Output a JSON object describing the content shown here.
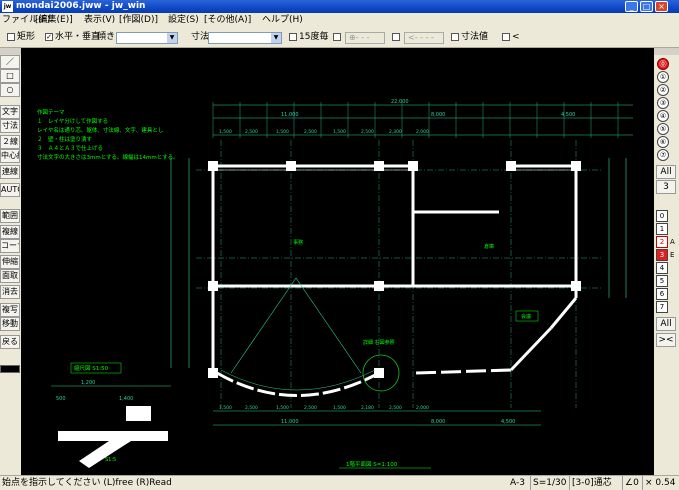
{
  "window": {
    "app_icon": "jw",
    "title": "mondai2006.jww - jw_win"
  },
  "menu": [
    "ファイル(F)",
    "[編集(E)]",
    "表示(V)",
    "[作図(D)]",
    "設定(S)",
    "[その他(A)]",
    "ヘルプ(H)"
  ],
  "toolbar": {
    "rect_label": "矩形",
    "horiz_vert_label": "水平・垂直",
    "angle_label": "傾き",
    "dim_label": "寸法",
    "deg15_label": "15度毎",
    "dim_value_label": "寸法値",
    "lt_label": "<",
    "grayed1": "⊕- - -",
    "grayed2": "<- - - -"
  },
  "left_tools": [
    "／",
    "□",
    "○",
    "文字",
    "寸法",
    "２線",
    "中心線",
    "連線",
    "AUTO",
    "範囲",
    "複線",
    "コーナー",
    "伸縮",
    "面取",
    "消去",
    "複写",
    "移動",
    "戻る"
  ],
  "right_tools": {
    "groups": [
      "⓪",
      "①",
      "②",
      "③",
      "④",
      "⑤",
      "⑥",
      "⑦"
    ],
    "all_label": "All",
    "all_num": "3",
    "layers": [
      "0",
      "1",
      "2",
      "3",
      "4",
      "5",
      "6",
      "7"
    ],
    "layer_suffix": [
      "",
      "",
      "A",
      "E",
      "",
      "",
      "",
      ""
    ],
    "layer_all": "All",
    "x_label": "><"
  },
  "drawing": {
    "notes": [
      "作図テーマ",
      "１　レイヤ分けして作図する",
      "レイヤ名は通り芯、躯体、寸法線、文字、建具とし",
      "２　壁・柱は塗り潰す",
      "３　Ａ４とＡ３で仕上げる",
      "寸法文字の大きさは3mmとする。線幅は14mmとする。"
    ],
    "total_dim": "22,000",
    "dims_top": [
      "11,000",
      "8,000",
      "4,500"
    ],
    "dims_top2": [
      "1,500",
      "2,500",
      "1,500",
      "2,500",
      "1,500",
      "2,500",
      "2,300",
      "2,000"
    ],
    "dims_bottom": [
      "1,500",
      "2,500",
      "1,500",
      "2,500",
      "1,500",
      "2,180",
      "2,500",
      "2,000"
    ],
    "dims_bottom2": [
      "11,000",
      "8,000",
      "4,500"
    ],
    "room_label": "事務",
    "room_label2": "倉庫",
    "room_label3": "会議",
    "note_label": "詳細 右図参照",
    "scale_label": "縮尺図 S1:50",
    "plan_title": "1階平面図 S=1:100",
    "inset_dims": [
      "1,200",
      "500",
      "1,400"
    ],
    "inset_scale": "S1:5"
  },
  "status": {
    "prompt": "始点を指示してください (L)free (R)Read",
    "paper": "A-3",
    "scale": "S=1/30",
    "layer": "[3-0]通芯",
    "angle": "∠0",
    "zoom": "× 0.54"
  },
  "colors": {
    "canvas_bg": "#000000",
    "dim_line": "#2dd0a0",
    "wall": "#ffffff",
    "text_green": "#00ff00",
    "accent_red": "#e02020"
  }
}
